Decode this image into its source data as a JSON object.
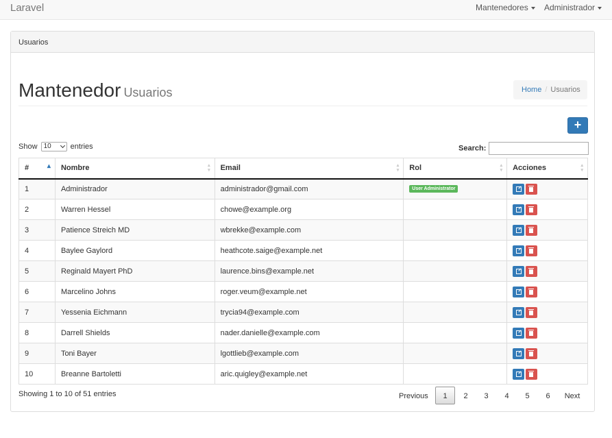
{
  "navbar": {
    "brand": "Laravel",
    "menus": [
      {
        "label": "Mantenedores"
      },
      {
        "label": "Administrador"
      }
    ]
  },
  "panel": {
    "heading": "Usuarios",
    "title": "Mantenedor",
    "subtitle": "Usuarios",
    "breadcrumb": {
      "home": "Home",
      "current": "Usuarios"
    },
    "add_button_icon": "plus-icon"
  },
  "controls": {
    "show_label": "Show",
    "entries_value": "10",
    "entries_label": "entries",
    "search_label": "Search:",
    "search_value": ""
  },
  "table": {
    "columns": [
      "#",
      "Nombre",
      "Email",
      "Rol",
      "Acciones"
    ],
    "rows": [
      {
        "id": "1",
        "name": "Administrador",
        "email": "administrador@gmail.com",
        "role": "User Administrator"
      },
      {
        "id": "2",
        "name": "Warren Hessel",
        "email": "chowe@example.org",
        "role": ""
      },
      {
        "id": "3",
        "name": "Patience Streich MD",
        "email": "wbrekke@example.com",
        "role": ""
      },
      {
        "id": "4",
        "name": "Baylee Gaylord",
        "email": "heathcote.saige@example.net",
        "role": ""
      },
      {
        "id": "5",
        "name": "Reginald Mayert PhD",
        "email": "laurence.bins@example.net",
        "role": ""
      },
      {
        "id": "6",
        "name": "Marcelino Johns",
        "email": "roger.veum@example.net",
        "role": ""
      },
      {
        "id": "7",
        "name": "Yessenia Eichmann",
        "email": "trycia94@example.com",
        "role": ""
      },
      {
        "id": "8",
        "name": "Darrell Shields",
        "email": "nader.danielle@example.com",
        "role": ""
      },
      {
        "id": "9",
        "name": "Toni Bayer",
        "email": "lgottlieb@example.com",
        "role": ""
      },
      {
        "id": "10",
        "name": "Breanne Bartoletti",
        "email": "aric.quigley@example.net",
        "role": ""
      }
    ],
    "action_icons": [
      "edit-icon",
      "trash-icon"
    ]
  },
  "footer": {
    "info": "Showing 1 to 10 of 51 entries",
    "pagination": {
      "previous": "Previous",
      "pages": [
        "1",
        "2",
        "3",
        "4",
        "5",
        "6"
      ],
      "active": "1",
      "next": "Next"
    }
  },
  "colors": {
    "primary": "#337ab7",
    "danger": "#d9534f",
    "success": "#5cb85c"
  }
}
